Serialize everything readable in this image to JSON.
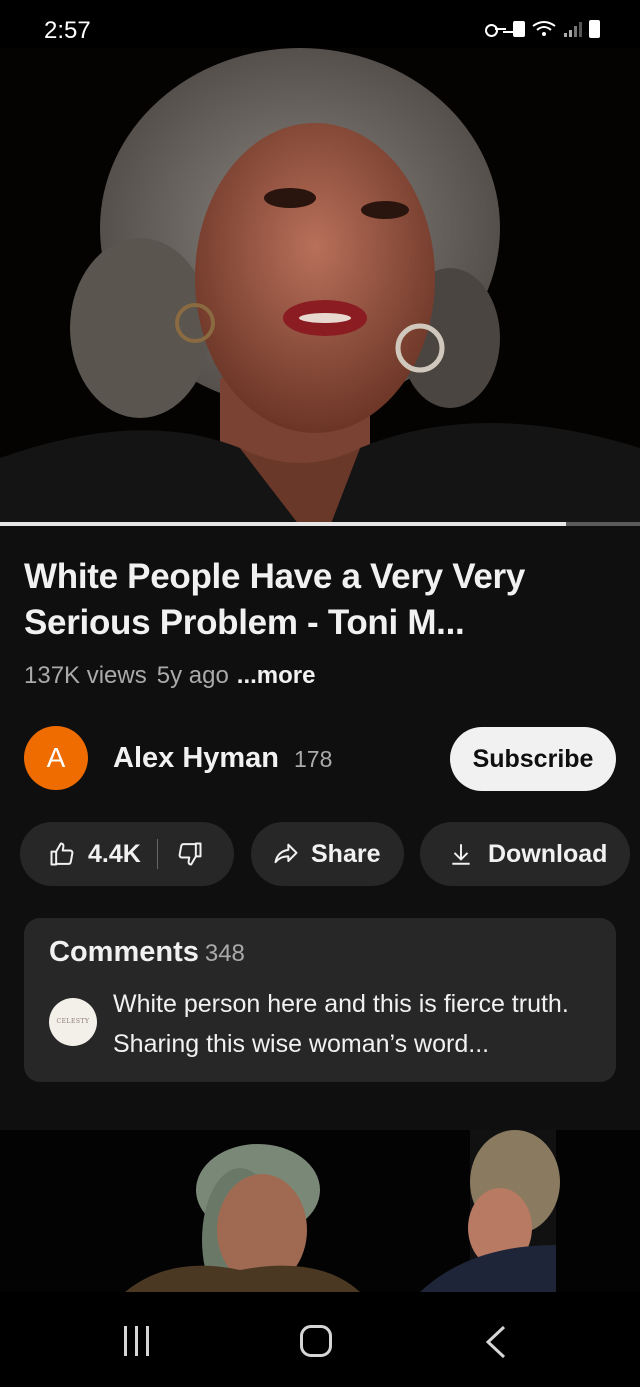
{
  "status_bar": {
    "time": "2:57",
    "icons": [
      "vpn-key-icon",
      "lock-icon",
      "wifi-icon",
      "signal-icon",
      "battery-icon"
    ]
  },
  "player": {
    "progress": 0.885
  },
  "video": {
    "title": "White People Have a Very Very Serious Problem - Toni  M...",
    "views": "137K views",
    "age": "5y ago",
    "more_label": "...more"
  },
  "channel": {
    "avatar_letter": "A",
    "name": "Alex Hyman",
    "subscriber_count": "178",
    "subscribe_label": "Subscribe",
    "avatar_color": "#ef6c00"
  },
  "actions": {
    "like_count": "4.4K",
    "share_label": "Share",
    "download_label": "Download"
  },
  "comments": {
    "title": "Comments",
    "count": "348",
    "top_comment": {
      "avatar_text": "CELESTY",
      "text": "White person here and this is fierce truth. Sharing this wise woman’s word..."
    }
  },
  "nav": {
    "buttons": [
      "recents-icon",
      "home-icon",
      "back-icon"
    ]
  },
  "colors": {
    "background": "#0f0f0f",
    "surface": "#272727",
    "text_secondary": "#aaaaaa"
  }
}
